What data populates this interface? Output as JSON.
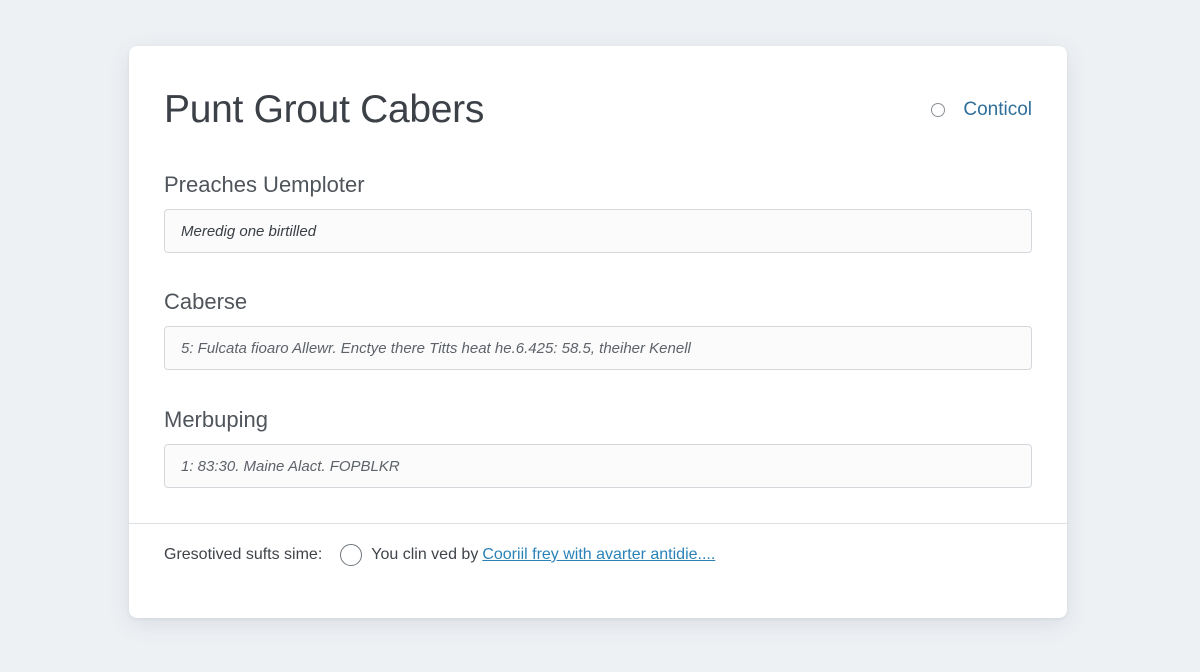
{
  "header": {
    "title": "Punt Grout Cabers",
    "action_label": "Conticol"
  },
  "fields": [
    {
      "label": "Preaches Uemploter",
      "value": "Meredig one birtilled"
    },
    {
      "label": "Caberse",
      "value": "5: Fulcata fioaro Allewr. Enctye there Titts heat he.6.425: 58.5, theiher Kenell"
    },
    {
      "label": "Merbuping",
      "value": "1: 83:30. Maine Alact. FOPBLKR"
    }
  ],
  "footer": {
    "label": "Gresotived sufts sime:",
    "text": "You clin ved by",
    "link_text": "Cooriil frey with avarter antidie...."
  },
  "colors": {
    "page_background": "#eef1f4",
    "card_background": "#ffffff",
    "accent_link": "#2a82b8",
    "header_link": "#2f6f9a"
  },
  "icons": {
    "header_action": "radio-circle-icon",
    "footer_option": "radio-circle-icon"
  }
}
